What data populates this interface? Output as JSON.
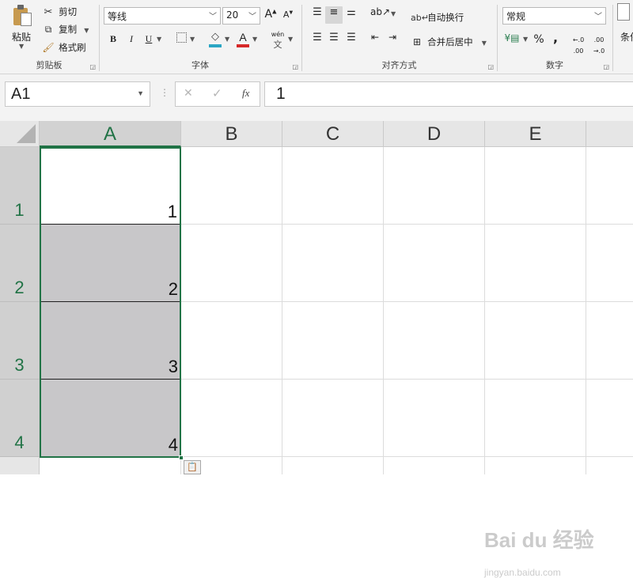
{
  "ribbon": {
    "clipboard": {
      "group_label": "剪贴板",
      "paste_label": "粘贴",
      "cut_label": "剪切",
      "copy_label": "复制",
      "format_painter_label": "格式刷"
    },
    "font": {
      "group_label": "字体",
      "font_name": "等线",
      "font_size": "20",
      "bold_label": "B",
      "italic_label": "I",
      "underline_label": "U",
      "phonetic_label": "wén"
    },
    "alignment": {
      "group_label": "对齐方式",
      "wrap_text_label": "自动换行",
      "merge_center_label": "合并后居中"
    },
    "number": {
      "group_label": "数字",
      "format_value": "常规",
      "percent_label": "%",
      "comma_label": ","
    },
    "styles": {
      "partial_label": "条件"
    }
  },
  "formula_bar": {
    "name_box_value": "A1",
    "cancel_icon": "✕",
    "enter_icon": "✓",
    "fx_label": "fx",
    "formula_value": "1"
  },
  "sheet": {
    "columns": [
      "A",
      "B",
      "C",
      "D",
      "E"
    ],
    "rows": [
      {
        "number": "1",
        "value": "1"
      },
      {
        "number": "2",
        "value": "2"
      },
      {
        "number": "3",
        "value": "3"
      },
      {
        "number": "4",
        "value": "4"
      }
    ],
    "active_cell": "A1",
    "selection": "A1:A4"
  },
  "watermark": {
    "brand": "Bai du 经验",
    "url": "jingyan.baidu.com"
  },
  "colors": {
    "accent_green": "#217346",
    "font_color_red": "#d62828",
    "fill_color_yellow": "#f7d54a"
  },
  "icons": [
    "paste-icon",
    "cut-icon",
    "copy-icon",
    "format-painter-icon",
    "grow-font-icon",
    "shrink-font-icon",
    "border-icon",
    "fill-color-icon",
    "font-color-icon",
    "phonetic-icon",
    "align-top-icon",
    "align-middle-icon",
    "align-bottom-icon",
    "orientation-icon",
    "align-left-icon",
    "align-center-icon",
    "align-right-icon",
    "decrease-indent-icon",
    "increase-indent-icon",
    "wrap-text-icon",
    "merge-center-icon",
    "currency-icon",
    "percent-icon",
    "comma-icon",
    "increase-decimal-icon",
    "decrease-decimal-icon"
  ]
}
